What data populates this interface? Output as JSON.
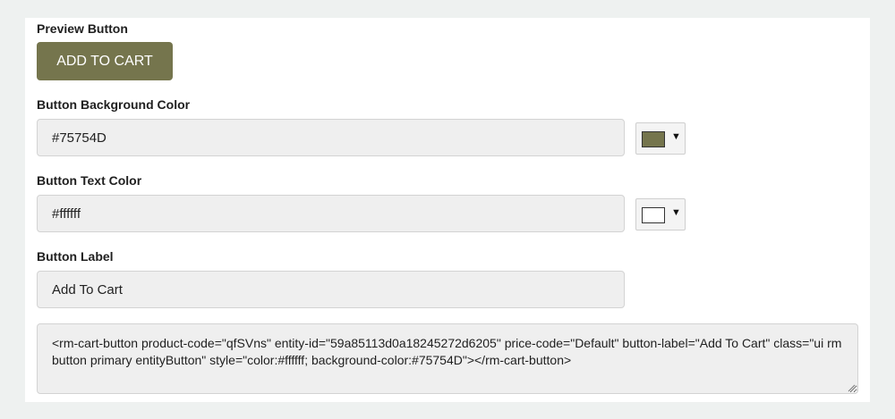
{
  "preview": {
    "section_label": "Preview Button",
    "button_label": "ADD TO CART"
  },
  "background_color": {
    "label": "Button Background Color",
    "value": "#75754D"
  },
  "text_color": {
    "label": "Button Text Color",
    "value": "#ffffff"
  },
  "button_label": {
    "label": "Button Label",
    "value": "Add To Cart"
  },
  "embed_code": "<rm-cart-button product-code=\"qfSVns\" entity-id=\"59a85113d0a18245272d6205\" price-code=\"Default\" button-label=\"Add To Cart\" class=\"ui rm button primary entityButton\" style=\"color:#ffffff; background-color:#75754D\"></rm-cart-button>",
  "icons": {
    "picker_caret": "▼"
  }
}
